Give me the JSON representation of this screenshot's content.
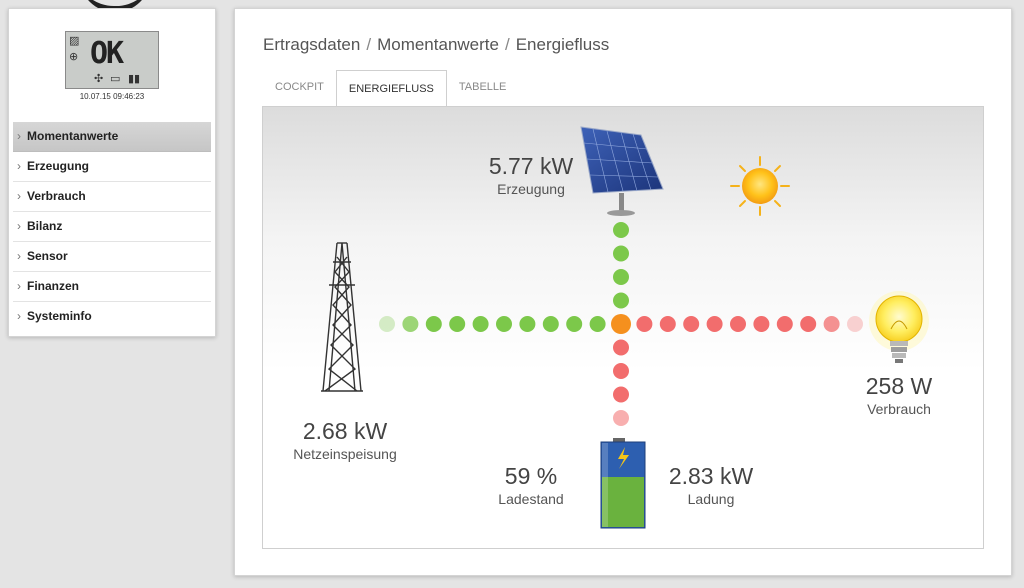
{
  "sidebar": {
    "lcd_text": "OK",
    "timestamp": "10.07.15 09:46:23",
    "items": [
      {
        "label": "Momentanwerte"
      },
      {
        "label": "Erzeugung"
      },
      {
        "label": "Verbrauch"
      },
      {
        "label": "Bilanz"
      },
      {
        "label": "Sensor"
      },
      {
        "label": "Finanzen"
      },
      {
        "label": "Systeminfo"
      }
    ]
  },
  "breadcrumb": [
    "Ertragsdaten",
    "Momentanwerte",
    "Energiefluss"
  ],
  "tabs": [
    {
      "label": "COCKPIT"
    },
    {
      "label": "ENERGIEFLUSS"
    },
    {
      "label": "TABELLE"
    }
  ],
  "energy": {
    "generation": {
      "value": "5.77 kW",
      "label": "Erzeugung"
    },
    "consumption": {
      "value": "258 W",
      "label": "Verbrauch"
    },
    "grid": {
      "value": "2.68 kW",
      "label": "Netzeinspeisung"
    },
    "battery_soc": {
      "value": "59 %",
      "label": "Ladestand",
      "level": 59
    },
    "battery_power": {
      "value": "2.83 kW",
      "label": "Ladung"
    }
  },
  "colors": {
    "flow_green": "#7cc84a",
    "flow_red": "#f26d6d",
    "hub_orange": "#f5901e",
    "battery_green": "#6ab23e",
    "battery_blue": "#2d5fb0"
  }
}
